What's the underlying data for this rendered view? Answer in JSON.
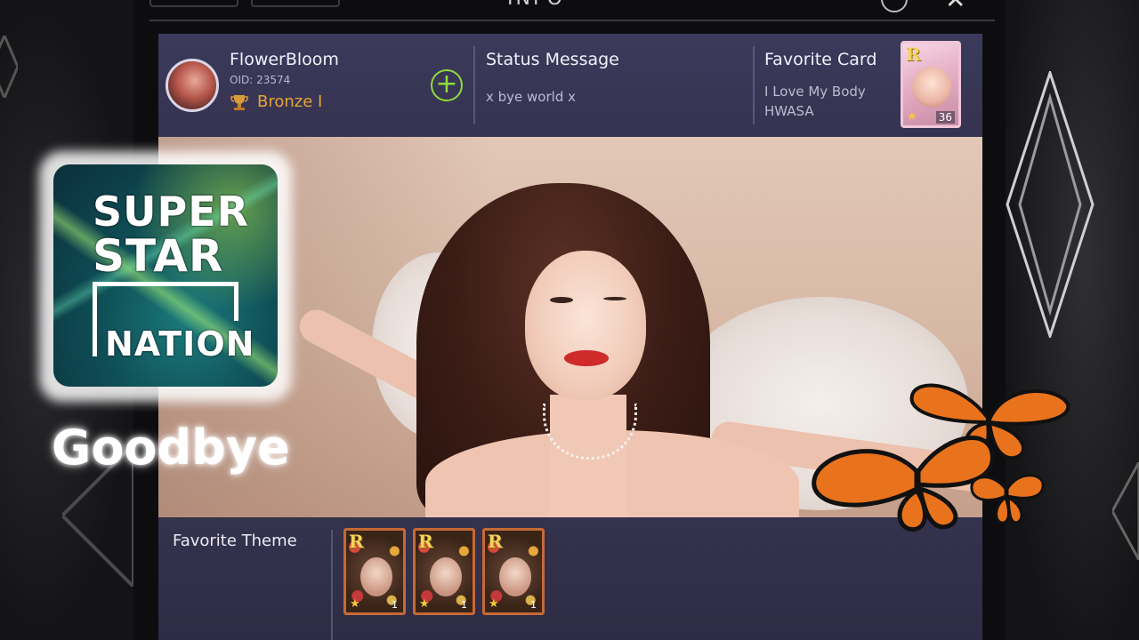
{
  "header": {
    "title": "INFO"
  },
  "profile": {
    "username": "FlowerBloom",
    "oid": "OID: 23574",
    "rank": "Bronze I",
    "status_title": "Status Message",
    "status_text": "x bye world x",
    "favorite_card_title": "Favorite Card",
    "favorite_card_song": "I Love My Body",
    "favorite_card_artist": "HWASA",
    "favorite_card_grade": "R",
    "favorite_card_level": "36"
  },
  "theme": {
    "label": "Favorite Theme",
    "cards": [
      {
        "grade": "R",
        "count": "1"
      },
      {
        "grade": "R",
        "count": "1"
      },
      {
        "grade": "R",
        "count": "1"
      }
    ]
  },
  "overlay": {
    "logo_line1": "SUPER",
    "logo_line2": "STAR",
    "logo_line3": "NATION",
    "caption": "Goodbye"
  },
  "colors": {
    "rank": "#e6a43a",
    "add_button": "#8fdc3b",
    "panel": "#3c3a5c"
  }
}
